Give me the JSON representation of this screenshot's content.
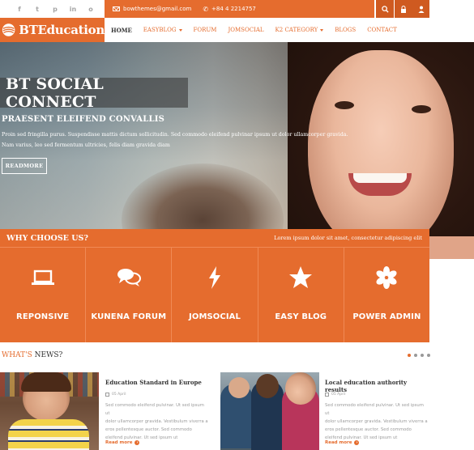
{
  "social": {
    "icons": [
      "f",
      "t",
      "p",
      "in",
      "o"
    ]
  },
  "contact": {
    "email": "bowthemes@gmail.com",
    "phone": "+84 4 2214757"
  },
  "brand": {
    "logo_text": "BTEducation",
    "accent_color": "#e56c2e"
  },
  "nav": {
    "items": [
      {
        "label": "Home"
      },
      {
        "label": "EasyBlog"
      },
      {
        "label": "Forum"
      },
      {
        "label": "JomSocial"
      },
      {
        "label": "K2 Category"
      },
      {
        "label": "Blogs"
      },
      {
        "label": "Contact"
      }
    ]
  },
  "hero": {
    "title": "BT SOCIAL CONNECT",
    "subtitle": "PRAESENT ELEIFEND CONVALLIS",
    "text_line1": "Proin sed fringilla purus. Suspendisse mattis dictum sollicitudin. Sed commodo eleifend pulvinar ipsum ut dolor ullamcorper gravida.",
    "text_line2": "Nam varius, leo sed fermentum ultricies, felis diam gravida diam",
    "button": "READMORE"
  },
  "why": {
    "title": "WHY CHOOSE US?",
    "tagline": "Lorem ipsum dolor sit amet, consectetur adipiscing elit",
    "features": [
      {
        "label": "REPONSIVE",
        "icon": "laptop-icon"
      },
      {
        "label": "KUNENA FORUM",
        "icon": "chat-icon"
      },
      {
        "label": "JOMSOCIAL",
        "icon": "lightning-icon"
      },
      {
        "label": "EASY BLOG",
        "icon": "star-icon"
      },
      {
        "label": "POWER ADMIN",
        "icon": "asterisk-icon"
      }
    ]
  },
  "news": {
    "title_accent": "WHAT'S",
    "title_rest": "NEWS?",
    "cards": [
      {
        "title": "Education Standard in Europe",
        "date": "05 April",
        "text_line1": "Sed commodo eleifend pulvinar. Ut sed ipsum ut",
        "text_line2": "dolor ullamcorper gravida. Vestibulum viverra a",
        "text_line3": "eros pellentesque auctor. Sed commodo",
        "text_line4": "eleifend pulvinar. Ut sed ipsum ut",
        "more": "Read more"
      },
      {
        "title": "Local education authority results",
        "date": "05 April",
        "text_line1": "Sed commodo eleifend pulvinar. Ut sed ipsum ut",
        "text_line2": "dolor ullamcorper gravida. Vestibulum viverra a",
        "text_line3": "eros pellentesque auctor. Sed commodo",
        "text_line4": "eleifend pulvinar. Ut sed ipsum ut",
        "more": "Read more"
      }
    ]
  }
}
